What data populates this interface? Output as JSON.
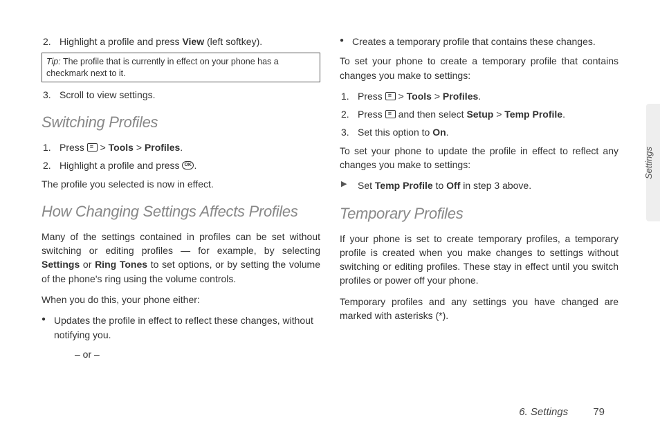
{
  "col1": {
    "step2_pre": "Highlight a profile and press ",
    "step2_bold": "View",
    "step2_post": "  (left softkey).",
    "tip_label": "Tip:",
    "tip_text": " The profile that is currently in effect on your phone has a checkmark next to it.",
    "step3": "Scroll to view settings.",
    "h_switch": "Switching Profiles",
    "sw1_pre": "Press ",
    "sw1_b1": "Tools",
    "sw1_b2": "Profiles",
    "sw2_pre": "Highlight a profile and press ",
    "sw_result": "The profile you selected is now in effect.",
    "h_changing": "How Changing Settings Affects Profiles",
    "chg_p1a": "Many of the settings contained in profiles can be set without switching or editing profiles — for example, by selecting ",
    "chg_b1": "Settings",
    "chg_mid": " or ",
    "chg_b2": "Ring Tones",
    "chg_p1b": " to set options, or by setting the volume of the phone's ring using the volume controls.",
    "chg_p2": "When you do this, your phone either:",
    "bul1": "Updates the profile in effect to reflect these changes, without notifying you.",
    "or": "– or –"
  },
  "col2": {
    "bul2": "Creates a temporary profile that contains these changes.",
    "set_create": "To set your phone to create a temporary profile that contains changes you make to settings:",
    "c1_b1": "Tools",
    "c1_b2": "Profiles",
    "c2_mid": " and then select ",
    "c2_b1": "Setup",
    "c2_b2": "Temp Profile",
    "c3_pre": "Set this option to ",
    "c3_b": "On",
    "set_update": "To set your phone to update the profile in effect to reflect any changes you make to settings:",
    "arr_pre": "Set ",
    "arr_b1": "Temp Profile",
    "arr_mid": " to ",
    "arr_b2": "Off",
    "arr_post": " in step 3 above.",
    "h_temp": "Temporary Profiles",
    "tp1": "If your phone is set to create temporary profiles, a temporary profile is created when you make changes to settings without switching or editing profiles. These stay in effect until you switch profiles or power off your phone.",
    "tp2": "Temporary profiles and any settings you have changed are marked with asterisks (*)."
  },
  "side": "Settings",
  "footer_chapter": "6. Settings",
  "footer_page": "79",
  "glyph_gt": " > ",
  "press": "Press "
}
